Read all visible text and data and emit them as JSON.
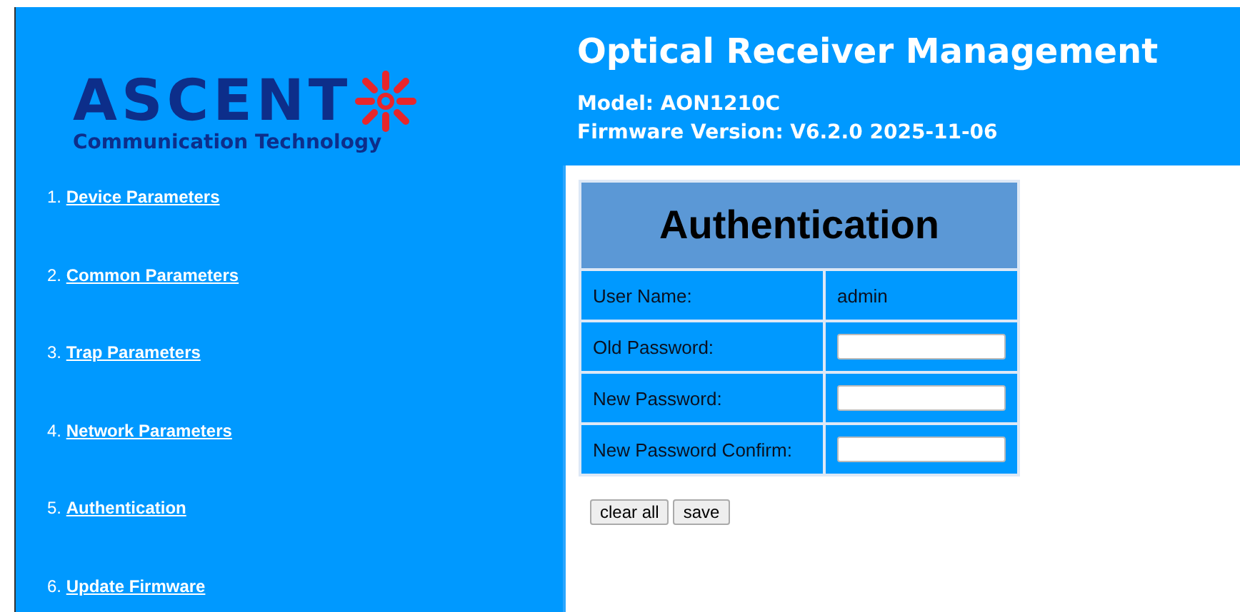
{
  "logo": {
    "name": "ASCENT",
    "tagline": "Communication Technology"
  },
  "header": {
    "title": "Optical Receiver Management",
    "model": "Model: AON1210C",
    "firmware": "Firmware Version: V6.2.0 2025-11-06"
  },
  "sidebar": {
    "items": [
      {
        "number": "1.",
        "label": "Device Parameters"
      },
      {
        "number": "2.",
        "label": "Common Parameters"
      },
      {
        "number": "3.",
        "label": "Trap Parameters"
      },
      {
        "number": "4.",
        "label": "Network Parameters"
      },
      {
        "number": "5.",
        "label": "Authentication"
      },
      {
        "number": "6.",
        "label": "Update Firmware"
      }
    ]
  },
  "form": {
    "title": "Authentication",
    "rows": [
      {
        "kind": "text",
        "label": "User Name:",
        "value": "admin"
      },
      {
        "kind": "input",
        "label": "Old Password:"
      },
      {
        "kind": "input",
        "label": "New Password:"
      },
      {
        "kind": "input",
        "label": "New Password Confirm:"
      }
    ],
    "buttons": [
      "clear all",
      "save"
    ]
  }
}
